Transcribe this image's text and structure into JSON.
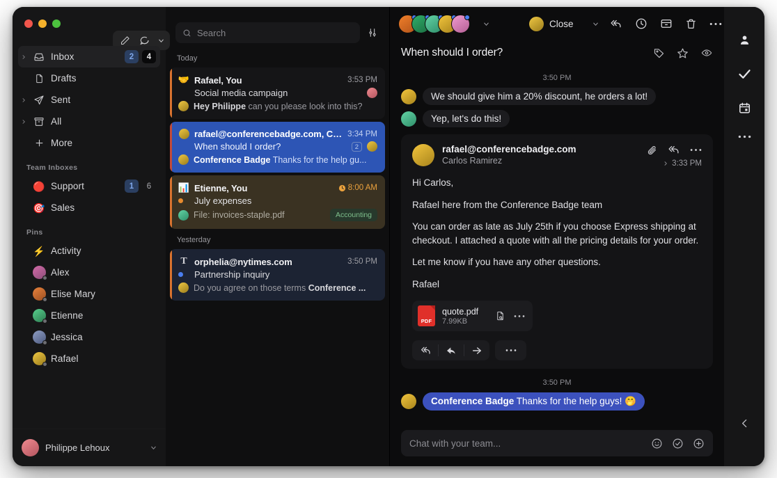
{
  "window": {
    "traffic_lights": [
      "close",
      "minimize",
      "maximize"
    ]
  },
  "sidebar": {
    "compose": {
      "edit_icon": "pencil-icon",
      "chat_icon": "chat-bubble-icon",
      "chevron": "chevron-down-icon"
    },
    "nav": [
      {
        "label": "Inbox",
        "icon": "inbox-icon",
        "expandable": true,
        "active": true,
        "badge_blue": "2",
        "badge_dark": "4"
      },
      {
        "label": "Drafts",
        "icon": "draft-icon",
        "expandable": false,
        "active": false,
        "badge_blue": "",
        "badge_dark": ""
      },
      {
        "label": "Sent",
        "icon": "send-icon",
        "expandable": true,
        "active": false,
        "badge_blue": "",
        "badge_dark": ""
      },
      {
        "label": "All",
        "icon": "archive-icon",
        "expandable": true,
        "active": false,
        "badge_blue": "",
        "badge_dark": ""
      },
      {
        "label": "More",
        "icon": "plus-icon",
        "expandable": false,
        "active": false,
        "badge_blue": "",
        "badge_dark": ""
      }
    ],
    "team_inboxes_title": "Team Inboxes",
    "team_inboxes": [
      {
        "label": "Support",
        "emoji": "🔴",
        "badge_blue": "1",
        "badge_plain": "6"
      },
      {
        "label": "Sales",
        "emoji": "🎯",
        "badge_blue": "",
        "badge_plain": ""
      }
    ],
    "pins_title": "Pins",
    "pins": [
      {
        "label": "Activity",
        "emoji": "⚡",
        "avatar": false,
        "color1": "",
        "color2": ""
      },
      {
        "label": "Alex",
        "emoji": "",
        "avatar": true,
        "color1": "#d36ba8",
        "color2": "#8c4e7a"
      },
      {
        "label": "Elise Mary",
        "emoji": "",
        "avatar": true,
        "color1": "#e8823c",
        "color2": "#9c4f22"
      },
      {
        "label": "Etienne",
        "emoji": "",
        "avatar": true,
        "color1": "#57cf8c",
        "color2": "#2e7d52"
      },
      {
        "label": "Jessica",
        "emoji": "",
        "avatar": true,
        "color1": "#8f9ec4",
        "color2": "#4e5b80"
      },
      {
        "label": "Rafael",
        "emoji": "",
        "avatar": true,
        "color1": "#f0c843",
        "color2": "#9a7c1c"
      }
    ],
    "user": {
      "name": "Philippe Lehoux",
      "chevron": "chevron-down-icon"
    }
  },
  "list": {
    "search": {
      "placeholder": "Search",
      "icon": "search-icon",
      "filter_icon": "filter-sliders-icon"
    },
    "groups": [
      {
        "day": "Today",
        "items": [
          {
            "from": "Rafael, You",
            "time": "3:53 PM",
            "has_clock": false,
            "subject": "Social media campaign",
            "preview_bold": "Hey Philippe",
            "preview_rest": " can you please look into this?",
            "icon_emoji": "🤝",
            "unread_dot": "",
            "count": "",
            "tag": "",
            "selected": false,
            "accent": "#d9732f",
            "bg": "#151517"
          },
          {
            "from": "rafael@conferencebadge.com, Carl...",
            "time": "3:34 PM",
            "has_clock": false,
            "subject": "When should I order?",
            "preview_bold": "Conference Badge",
            "preview_rest": " Thanks for the help gu...",
            "icon_emoji": "",
            "unread_dot": "",
            "count": "2",
            "tag": "",
            "selected": true,
            "accent": "#c14a3a",
            "bg": "#2d55b5"
          },
          {
            "from": "Etienne, You",
            "time": "8:00 AM",
            "has_clock": true,
            "subject": "July expenses",
            "preview_bold": "",
            "preview_rest": "File: invoices-staple.pdf",
            "icon_emoji": "📊",
            "unread_dot": "#e88b2e",
            "count": "",
            "tag": "Accounting",
            "selected": false,
            "accent": "#d9732f",
            "bg": "#3a3222"
          }
        ]
      },
      {
        "day": "Yesterday",
        "items": [
          {
            "from": "orphelia@nytimes.com",
            "time": "3:50 PM",
            "has_clock": false,
            "subject": "Partnership inquiry",
            "preview_bold": "",
            "preview_rest": "Do you agree on those terms ",
            "preview_bold2": "Conference ...",
            "icon_emoji": "𝔗",
            "unread_dot": "#4a7ef0",
            "count": "",
            "tag": "",
            "selected": false,
            "accent": "#d9732f",
            "bg": "#1c2333"
          }
        ]
      }
    ]
  },
  "reader": {
    "participants": [
      {
        "color1": "#f07f2a",
        "color2": "#b3541a"
      },
      {
        "color1": "#2fae6a",
        "color2": "#1b6f42"
      },
      {
        "color1": "#63d3a5",
        "color2": "#2f8f6a"
      },
      {
        "color1": "#f2c53d",
        "color2": "#a8841c"
      },
      {
        "color1": "#f09bd0",
        "color2": "#b55f95"
      }
    ],
    "participants_chevron": "chevron-down-icon",
    "close_label": "Close",
    "close_chevron": "chevron-down-icon",
    "top_actions": [
      "reply-all-icon",
      "snooze-clock-icon",
      "archive-box-icon",
      "trash-icon",
      "more-dots-icon"
    ],
    "subject": "When should I order?",
    "subject_actions": [
      "tag-icon",
      "star-icon",
      "eye-icon"
    ],
    "chat_above": {
      "timestamp": "3:50 PM",
      "messages": [
        {
          "text": "We should give him a 20% discount, he orders a lot!",
          "style": "grey",
          "av1": "#f2c53d",
          "av2": "#a8841c"
        },
        {
          "text": "Yep, let's do this!",
          "style": "grey",
          "av1": "#63d3a5",
          "av2": "#2f8f6a"
        }
      ]
    },
    "email": {
      "from": "rafael@conferencebadge.com",
      "to": "Carlos Ramirez",
      "time": "3:33 PM",
      "time_chevron": "chevron-right-icon",
      "head_icons": [
        "paperclip-icon",
        "reply-all-icon",
        "more-dots-icon"
      ],
      "paragraphs": [
        "Hi Carlos,",
        "Rafael here from the Conference Badge team",
        "You can order as late as July 25th if you choose Express shipping at checkout. I attached a quote with all the pricing details for your order.",
        "Let me know if you have any other questions.",
        "Rafael"
      ],
      "attachment": {
        "type_label": "PDF",
        "name": "quote.pdf",
        "size": "7.99KB",
        "actions": [
          "preview-file-icon",
          "more-dots-icon"
        ]
      },
      "reply_actions": [
        "reply-all-icon",
        "reply-icon",
        "forward-icon",
        "more-dots-icon"
      ]
    },
    "chat_below": {
      "timestamp": "3:50 PM",
      "message_bold": "Conference Badge",
      "message_rest": " Thanks for the help guys! 🤭",
      "av1": "#f2c53d",
      "av2": "#a8841c"
    },
    "composer": {
      "placeholder": "Chat with your team...",
      "icons": [
        "emoji-smiley-icon",
        "check-circle-icon",
        "plus-circle-icon"
      ]
    }
  },
  "rail": {
    "icons": [
      "person-icon",
      "check-icon",
      "calendar-icon",
      "more-dots-icon"
    ],
    "collapse_icon": "chevron-left-icon"
  },
  "colors": {
    "selected_blue": "#2d55b5",
    "accent_orange": "#d9732f",
    "bubble_blue": "#3c51bd",
    "tag_green_bg": "#27392c",
    "tag_green_fg": "#7fc08d"
  }
}
